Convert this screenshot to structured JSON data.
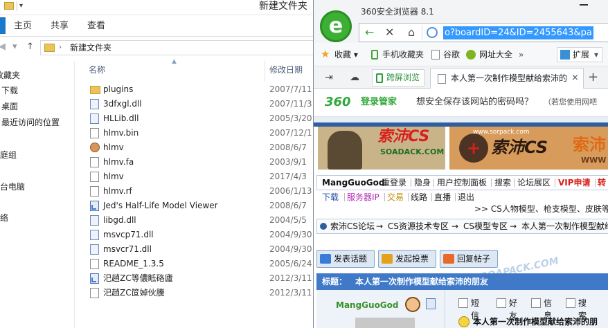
{
  "explorer": {
    "title": "新建文件夹",
    "ribbon": {
      "tabs": [
        "主页",
        "共享",
        "查看"
      ]
    },
    "address": {
      "path": "新建文件夹"
    },
    "nav": [
      "收藏夹",
      "下载",
      "桌面",
      "最近访问的位置",
      "家庭组",
      "这台电脑",
      "网络"
    ],
    "columns": {
      "name": "名称",
      "date": "修改日期"
    },
    "files": [
      {
        "name": "plugins",
        "date": "2007/7/11",
        "icon": "folder-icon"
      },
      {
        "name": "3dfxgl.dll",
        "date": "2007/11/3",
        "icon": "dll-file-icon"
      },
      {
        "name": "HLLib.dll",
        "date": "2005/3/20",
        "icon": "dll-file-icon"
      },
      {
        "name": "hlmv.bin",
        "date": "2007/12/1",
        "icon": "file-icon"
      },
      {
        "name": "hlmv",
        "date": "2008/6/7",
        "icon": "app-icon"
      },
      {
        "name": "hlmv.fa",
        "date": "2003/9/1",
        "icon": "file-icon"
      },
      {
        "name": "hlmv",
        "date": "2017/4/3",
        "icon": "file-icon"
      },
      {
        "name": "hlmv.rf",
        "date": "2006/1/13",
        "icon": "file-icon"
      },
      {
        "name": "Jed's Half-Life Model Viewer",
        "date": "2008/6/7",
        "icon": "shortcut-icon"
      },
      {
        "name": "libgd.dll",
        "date": "2004/5/5",
        "icon": "dll-file-icon"
      },
      {
        "name": "msvcp71.dll",
        "date": "2004/9/30",
        "icon": "dll-file-icon"
      },
      {
        "name": "msvcr71.dll",
        "date": "2004/9/30",
        "icon": "dll-file-icon"
      },
      {
        "name": "README_1.3.5",
        "date": "2005/6/24",
        "icon": "text-file-icon"
      },
      {
        "name": "汜趙ZC等儂眡硌廬",
        "date": "2012/3/11",
        "icon": "shortcut-icon"
      },
      {
        "name": "汜趙ZC笸婥伙黱",
        "date": "2012/3/11",
        "icon": "file-icon"
      }
    ]
  },
  "browser": {
    "title": "360安全浏览器 8.1",
    "url": "o?boardID=24&ID=2455643&pa",
    "favorites": {
      "collect": "收藏",
      "phone": "手机收藏夹",
      "gu": "谷歌",
      "nav": "网址大全",
      "more": "»",
      "ext": "扩展"
    },
    "tabs": {
      "kuaping": "跨屏浏览",
      "active": "本人第一次制作模型献给索沛的",
      "close": "×",
      "new": "+"
    },
    "password_bar": {
      "logo": "360",
      "brand": "登录管家",
      "question": "想安全保存该网站的密码吗？",
      "hint": "（若您使用网吧"
    },
    "page": {
      "banner1": {
        "title": "索沛CS",
        "domain": "SOADACK.COM"
      },
      "banner2": {
        "domain": "www.sorpack.com",
        "badge": "+",
        "title": "索沛CS",
        "title2": "索沛",
        "www": "WWW"
      },
      "userbar": {
        "user": "MangGuoGod",
        "items": [
          "重登录",
          "隐身",
          "用户控制面板",
          "搜索",
          "论坛展区"
        ],
        "vip": "VIP申请",
        "cut": "转"
      },
      "menu2": [
        {
          "text": "下载",
          "color": "#1d4fa8"
        },
        {
          "text": "服务器IP",
          "color": "#b52ab5"
        },
        {
          "text": "交易",
          "color": "#c88a00"
        },
        {
          "text": "线路",
          "color": "#222222"
        },
        {
          "text": "直播",
          "color": "#222222"
        },
        {
          "text": "退出",
          "color": "#222222"
        }
      ],
      "more_line": ">> CS人物模型、枪支模型、皮肤等",
      "breadcrumb": [
        "索沛CS论坛",
        "→",
        "CS资源技术专区",
        "→",
        "CS模型专区",
        "→",
        "本人第一次制作模型献给"
      ],
      "actions": [
        "发表话题",
        "发起投票",
        "回复帖子"
      ],
      "post": {
        "label": "标题：",
        "title": "本人第一次制作模型献给索沛的朋友",
        "watermark": "SOAPACK.COM",
        "author": "MangGuoGod",
        "post_actions": [
          "短信",
          "好友",
          "信息",
          "搜索"
        ],
        "first_line": "本人第一次制作模型献给索沛的朋"
      }
    }
  }
}
